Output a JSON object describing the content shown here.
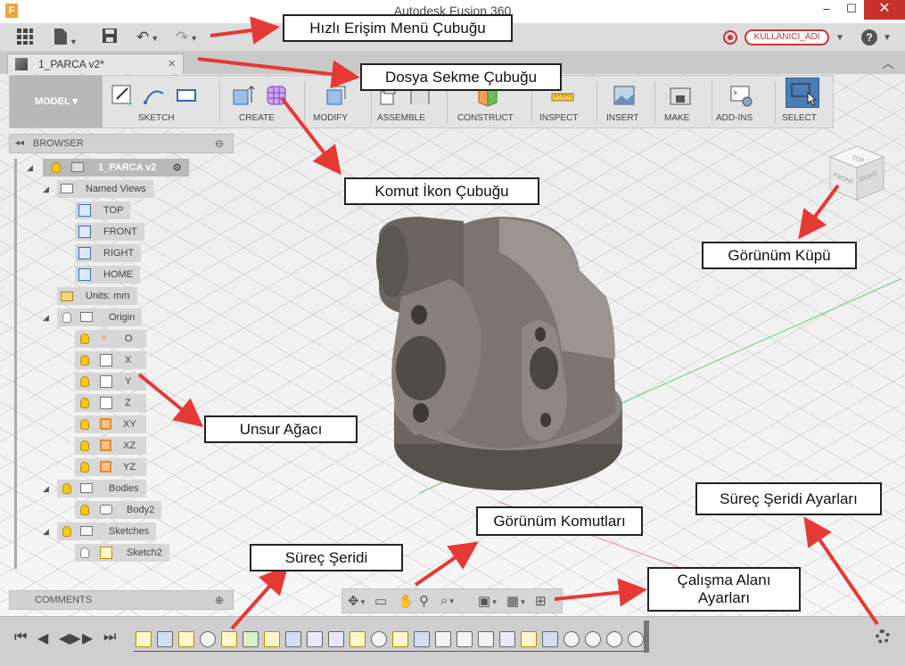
{
  "window": {
    "title": "Autodesk Fusion 360",
    "minimize": "–",
    "maximize": "☐",
    "close": "✕"
  },
  "quick_access": {
    "user_badge": "KULLANICI_ADI",
    "help": "?"
  },
  "tabs": {
    "document_tab": "1_PARCA v2*",
    "close_glyph": "×",
    "collapse_glyph": "︿"
  },
  "toolbar": {
    "workspace": "MODEL",
    "groups": [
      "SKETCH",
      "CREATE",
      "MODIFY",
      "ASSEMBLE",
      "CONSTRUCT",
      "INSPECT",
      "INSERT",
      "MAKE",
      "ADD-INS",
      "SELECT"
    ]
  },
  "browser": {
    "header": "BROWSER",
    "root": "1_PARCA v2",
    "named_views": "Named Views",
    "views": [
      "TOP",
      "FRONT",
      "RIGHT",
      "HOME"
    ],
    "units": "Units: mm",
    "origin": "Origin",
    "origin_items": [
      "O",
      "X",
      "Y",
      "Z",
      "XY",
      "XZ",
      "YZ"
    ],
    "bodies": "Bodies",
    "body_item": "Body2",
    "sketches": "Sketches",
    "sketch_item": "Sketch2"
  },
  "comments": {
    "label": "COMMENTS"
  },
  "viewcube": {
    "top": "TOP",
    "front": "FRONT",
    "right": "RIGHT"
  },
  "annotations": {
    "quick_access_bar": "Hızlı Erişim Menü Çubuğu",
    "file_tab_bar": "Dosya Sekme Çubuğu",
    "command_icon_bar": "Komut İkon Çubuğu",
    "view_cube": "Görünüm Küpü",
    "feature_tree": "Unsur Ağacı",
    "view_commands": "Görünüm Komutları",
    "timeline_settings": "Süreç Şeridi Ayarları",
    "timeline": "Süreç Şeridi",
    "workspace_settings": "Çalışma Alanı Ayarları"
  },
  "colors": {
    "accent_red": "#e53935",
    "toolbar_bg": "#e3e3e3",
    "select_blue": "#4c7db5",
    "model_gray": "#6f6a63"
  }
}
